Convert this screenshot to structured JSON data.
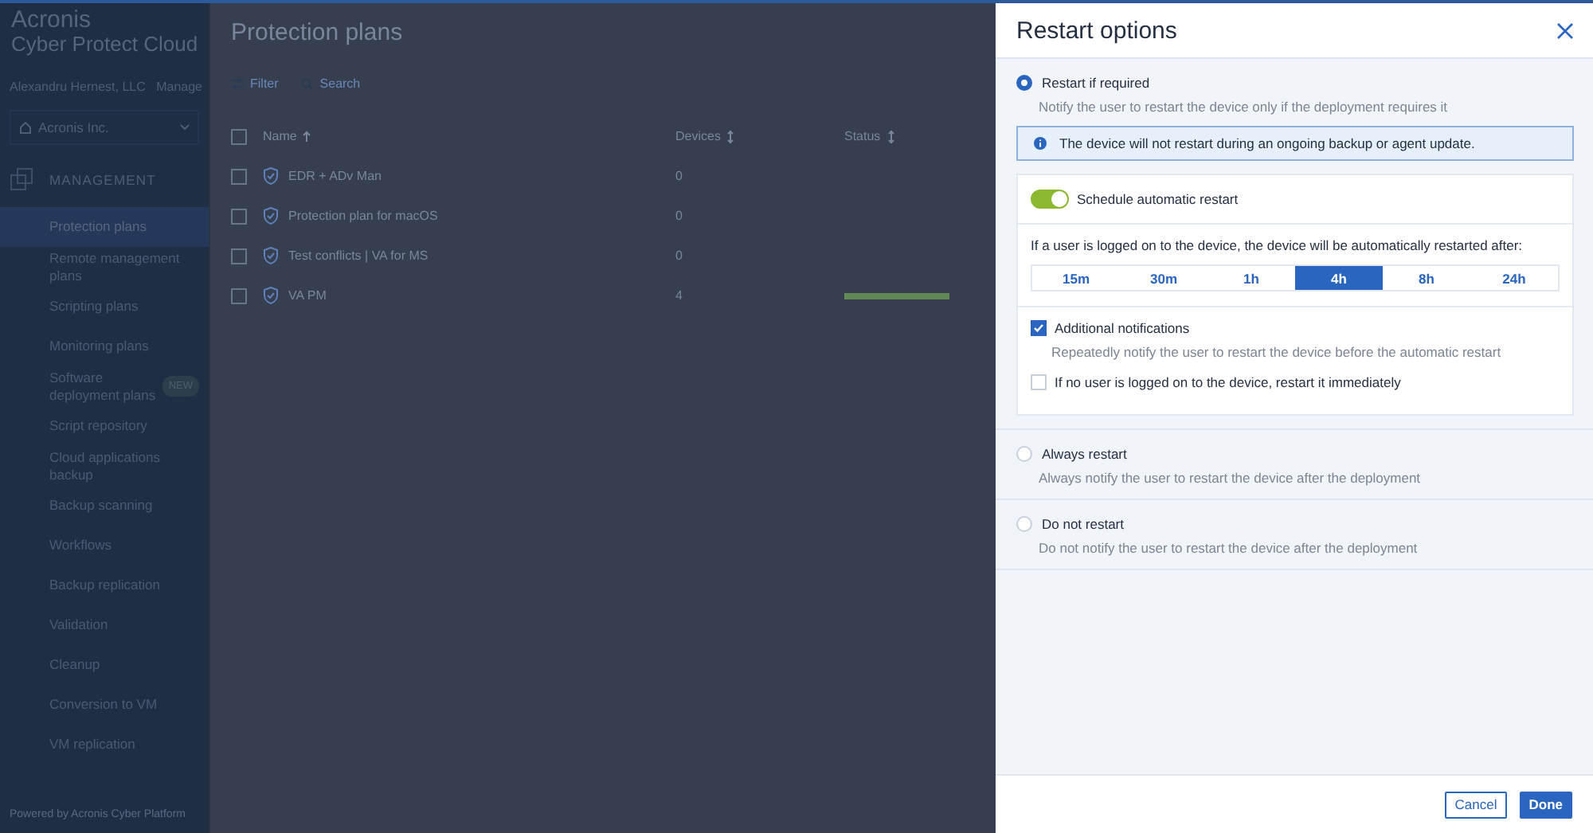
{
  "sidebar": {
    "logo_line1": "Acronis",
    "logo_line2": "Cyber Protect Cloud",
    "account": "Alexandru Hernest, LLC",
    "manage": "Manage",
    "tenant": "Acronis Inc.",
    "section": "MANAGEMENT",
    "items": [
      {
        "label": "Protection plans",
        "selected": true
      },
      {
        "label": "Remote management plans",
        "selected": false
      },
      {
        "label": "Scripting plans",
        "selected": false
      },
      {
        "label": "Monitoring plans",
        "selected": false
      },
      {
        "label": "Software deployment plans",
        "selected": false,
        "badge": "NEW"
      },
      {
        "label": "Script repository",
        "selected": false
      },
      {
        "label": "Cloud applications backup",
        "selected": false
      },
      {
        "label": "Backup scanning",
        "selected": false
      },
      {
        "label": "Workflows",
        "selected": false
      },
      {
        "label": "Backup replication",
        "selected": false
      },
      {
        "label": "Validation",
        "selected": false
      },
      {
        "label": "Cleanup",
        "selected": false
      },
      {
        "label": "Conversion to VM",
        "selected": false
      },
      {
        "label": "VM replication",
        "selected": false
      }
    ],
    "footer": "Powered by Acronis Cyber Platform"
  },
  "main": {
    "title": "Protection plans",
    "filter": "Filter",
    "search": "Search",
    "table": {
      "columns": [
        "Name",
        "Devices",
        "Status"
      ],
      "all_checked": false,
      "rows": [
        {
          "name": "EDR + ADv Man",
          "devices": "0",
          "checked": false
        },
        {
          "name": "Protection plan for macOS",
          "devices": "0",
          "checked": false
        },
        {
          "name": "Test conflicts | VA for MS",
          "devices": "0",
          "checked": false
        },
        {
          "name": "VA PM",
          "devices": "4",
          "checked": false,
          "status": {
            "level": 1
          }
        }
      ]
    }
  },
  "panel": {
    "title": "Restart options",
    "options": [
      {
        "label": "Restart if required",
        "description": "Notify the user to restart the device only if the deployment requires it",
        "selected": true,
        "details": {
          "info": "The device will not restart during an ongoing backup or agent update.",
          "schedule": {
            "label": "Schedule automatic restart",
            "on": true
          },
          "prompt": "If a user is logged on to the device, the device will be automatically restarted after:",
          "durations": [
            {
              "label": "15m",
              "selected": false
            },
            {
              "label": "30m",
              "selected": false
            },
            {
              "label": "1h",
              "selected": false
            },
            {
              "label": "4h",
              "selected": true
            },
            {
              "label": "8h",
              "selected": false
            },
            {
              "label": "24h",
              "selected": false
            }
          ],
          "checks": [
            {
              "label": "Additional notifications",
              "description": "Repeatedly notify the user to restart the device before the automatic restart",
              "checked": true
            },
            {
              "label": "If no user is logged on to the device, restart it immediately",
              "checked": false
            }
          ]
        }
      },
      {
        "label": "Always restart",
        "description": "Always notify the user to restart the device after the deployment",
        "selected": false
      },
      {
        "label": "Do not restart",
        "description": "Do not notify the user to restart the device after the deployment",
        "selected": false
      }
    ],
    "buttons": [
      {
        "label": "Cancel",
        "kind": "secondary"
      },
      {
        "label": "Done",
        "kind": "primary"
      }
    ]
  }
}
